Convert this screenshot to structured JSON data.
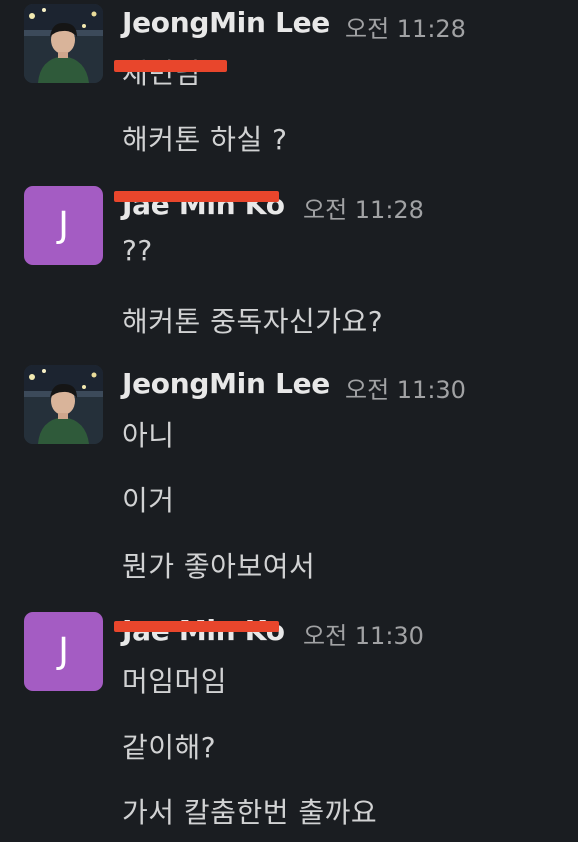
{
  "colors": {
    "background": "#1a1d21",
    "text": "#d1d2d3",
    "author": "#e8e8e8",
    "timestamp": "#a1a2a4",
    "avatar_purple": "#a45cc3",
    "redaction": "#e8462c"
  },
  "messages": [
    {
      "author": "JeongMin Lee",
      "avatar_type": "photo",
      "time": "오전 11:28",
      "lines": [
        "",
        "해커톤 하실 ?"
      ],
      "redacted_line_text": "재민님"
    },
    {
      "author": "Jae Min Ko",
      "avatar_type": "letter",
      "avatar_letter": "J",
      "author_redacted": true,
      "time": "오전 11:28",
      "lines": [
        "??",
        "해커톤 중독자신가요?"
      ]
    },
    {
      "author": "JeongMin Lee",
      "avatar_type": "photo",
      "time": "오전 11:30",
      "lines": [
        "아니",
        "이거",
        "뭔가 좋아보여서"
      ]
    },
    {
      "author": "Jae Min Ko",
      "avatar_type": "letter",
      "avatar_letter": "J",
      "author_redacted": true,
      "time": "오전 11:30",
      "lines": [
        "머임머임",
        "같이해?",
        "가서 칼춤한번 출까요"
      ]
    }
  ]
}
